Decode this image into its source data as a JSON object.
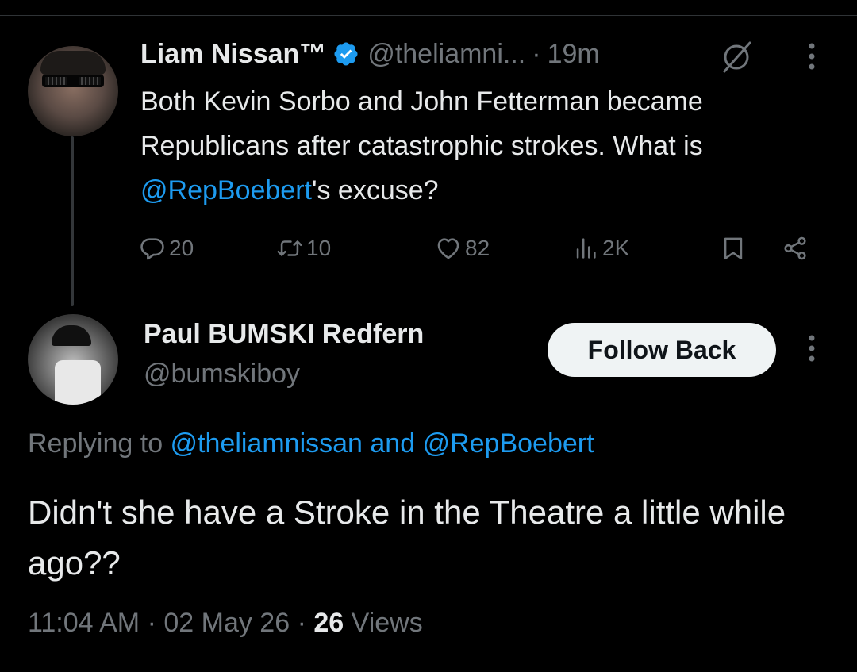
{
  "parent_tweet": {
    "display_name": "Liam Nissan™",
    "handle": "@theliamni...",
    "separator": "·",
    "time_ago": "19m",
    "text_before": "Both Kevin Sorbo and John Fetterman became Republicans after catastrophic strokes. What is ",
    "mention": "@RepBoebert",
    "text_after": "'s excuse?",
    "stats": {
      "replies": "20",
      "reposts": "10",
      "likes": "82",
      "views": "2K"
    }
  },
  "reply_tweet": {
    "display_name": "Paul BUMSKI Redfern",
    "handle": "@bumskiboy",
    "follow_button_label": "Follow Back",
    "replying_prefix": "Replying to ",
    "replying_user1": "@theliamnissan",
    "replying_and": " and ",
    "replying_user2": "@RepBoebert",
    "text": "Didn't she have a Stroke in the Theatre a little while ago??",
    "time": "11:04 AM",
    "date": "02 May 26",
    "meta_sep": " · ",
    "views_count": "26",
    "views_label": "Views"
  },
  "colors": {
    "background": "#000000",
    "text_primary": "#e7e9ea",
    "text_secondary": "#71767b",
    "link": "#1d9bf0",
    "verified": "#1d9bf0",
    "button_bg": "#eff3f4"
  },
  "icons": [
    "verified-badge-icon",
    "grok-icon",
    "more-options-icon",
    "reply-icon",
    "repost-icon",
    "like-icon",
    "views-icon",
    "bookmark-icon",
    "share-icon"
  ]
}
